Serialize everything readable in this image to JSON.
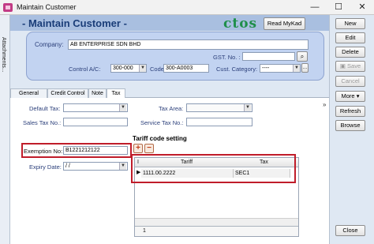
{
  "window": {
    "title": "Maintain Customer",
    "minimize_glyph": "—",
    "maximize_glyph": "☐",
    "close_glyph": "✕"
  },
  "side_tab": {
    "label": "Attachments..."
  },
  "header": {
    "title": "- Maintain Customer -",
    "logo_text": "ctos",
    "read_mykad_label": "Read MyKad"
  },
  "company_panel": {
    "company_label": "Company:",
    "company_value": "AB ENTERPRISE SDN BHD",
    "gst_label": "GST. No. :",
    "gst_value": "",
    "control_ac_label": "Control A/C:",
    "control_ac_value": "300-000",
    "code_label": "Code:",
    "code_value": "300-A0003",
    "cust_category_label": "Cust. Category:",
    "cust_category_value": "----"
  },
  "tabs": [
    {
      "label": "General"
    },
    {
      "label": "Credit Control"
    },
    {
      "label": "Note"
    },
    {
      "label": "Tax"
    }
  ],
  "tax_tab": {
    "default_tax_label": "Default Tax:",
    "default_tax_value": "",
    "tax_area_label": "Tax Area:",
    "tax_area_value": "",
    "sales_tax_no_label": "Sales Tax No.:",
    "sales_tax_no_value": "",
    "service_tax_no_label": "Service Tax No.:",
    "service_tax_no_value": "",
    "exemption_no_label": "Exemption No:",
    "exemption_no_value": "B1221212122",
    "expiry_date_label": "Expiry Date:",
    "expiry_date_value": " / /",
    "tariff_section_title": "Tariff code setting",
    "add_glyph": "+",
    "remove_glyph": "−",
    "grid": {
      "col_indicator": "I",
      "columns": [
        "Tariff",
        "Tax"
      ],
      "rows": [
        {
          "tariff": "1111.00.2222",
          "tax": "SEC1"
        }
      ],
      "row_marker": "▶",
      "footer_count": "1"
    }
  },
  "right_buttons": {
    "new": "New",
    "edit": "Edit",
    "delete": "Delete",
    "save": "Save",
    "cancel": "Cancel",
    "more": "More",
    "refresh": "Refresh",
    "browse": "Browse",
    "close": "Close"
  },
  "colors": {
    "highlight": "#c01d2a",
    "header_title": "#1a3d78",
    "logo": "#1f8f4a"
  }
}
